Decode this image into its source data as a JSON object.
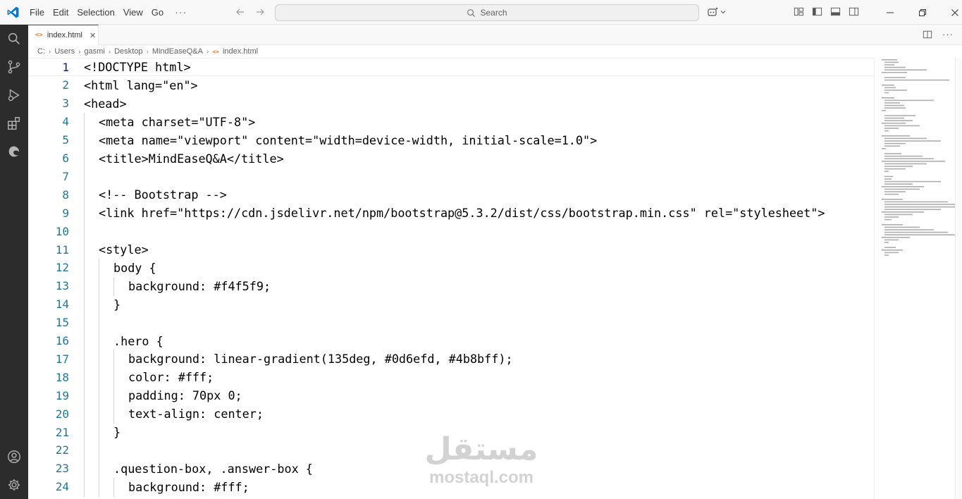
{
  "window": {
    "menu": [
      "File",
      "Edit",
      "Selection",
      "View",
      "Go"
    ],
    "menu_more": "···",
    "search_placeholder": "Search",
    "accent_color": "#005fb8"
  },
  "activity_bar": {
    "items": [
      "explorer-icon",
      "search-icon",
      "source-control-icon",
      "run-debug-icon",
      "extensions-icon",
      "edge-devtools-icon"
    ],
    "bottom_items": [
      "accounts-icon",
      "settings-gear-icon"
    ]
  },
  "tabs": [
    {
      "icon": "<>",
      "label": "index.html",
      "active": true
    }
  ],
  "breadcrumb": {
    "items": [
      "C:",
      "Users",
      "gasmi",
      "Desktop",
      "MindEaseQ&A"
    ],
    "file": "index.html",
    "file_icon": "<>"
  },
  "editor": {
    "language": "html",
    "current_line": 1,
    "lines": [
      {
        "n": "1",
        "indent": 0,
        "code": "<!DOCTYPE html>"
      },
      {
        "n": "2",
        "indent": 0,
        "code": "<html lang=\"en\">"
      },
      {
        "n": "3",
        "indent": 0,
        "code": "<head>"
      },
      {
        "n": "4",
        "indent": 1,
        "code": "<meta charset=\"UTF-8\">"
      },
      {
        "n": "5",
        "indent": 1,
        "code": "<meta name=\"viewport\" content=\"width=device-width, initial-scale=1.0\">"
      },
      {
        "n": "6",
        "indent": 1,
        "code": "<title>MindEaseQ&A</title>"
      },
      {
        "n": "7",
        "indent": 1,
        "code": ""
      },
      {
        "n": "8",
        "indent": 1,
        "code": "<!-- Bootstrap -->"
      },
      {
        "n": "9",
        "indent": 1,
        "code": "<link href=\"https://cdn.jsdelivr.net/npm/bootstrap@5.3.2/dist/css/bootstrap.min.css\" rel=\"stylesheet\">"
      },
      {
        "n": "10",
        "indent": 1,
        "code": ""
      },
      {
        "n": "11",
        "indent": 1,
        "code": "<style>"
      },
      {
        "n": "12",
        "indent": 2,
        "code": "body {"
      },
      {
        "n": "13",
        "indent": 3,
        "code": "background: #f4f5f9;"
      },
      {
        "n": "14",
        "indent": 2,
        "code": "}"
      },
      {
        "n": "15",
        "indent": 2,
        "code": ""
      },
      {
        "n": "16",
        "indent": 2,
        "code": ".hero {"
      },
      {
        "n": "17",
        "indent": 3,
        "code": "background: linear-gradient(135deg, #0d6efd, #4b8bff);"
      },
      {
        "n": "18",
        "indent": 3,
        "code": "color: #fff;"
      },
      {
        "n": "19",
        "indent": 3,
        "code": "padding: 70px 0;"
      },
      {
        "n": "20",
        "indent": 3,
        "code": "text-align: center;"
      },
      {
        "n": "21",
        "indent": 2,
        "code": "}"
      },
      {
        "n": "22",
        "indent": 2,
        "code": ""
      },
      {
        "n": "23",
        "indent": 2,
        "code": ".question-box, .answer-box {"
      },
      {
        "n": "24",
        "indent": 3,
        "code": "background: #fff;"
      }
    ]
  },
  "watermark": {
    "arabic": "مستقل",
    "latin": "mostaql.com"
  }
}
